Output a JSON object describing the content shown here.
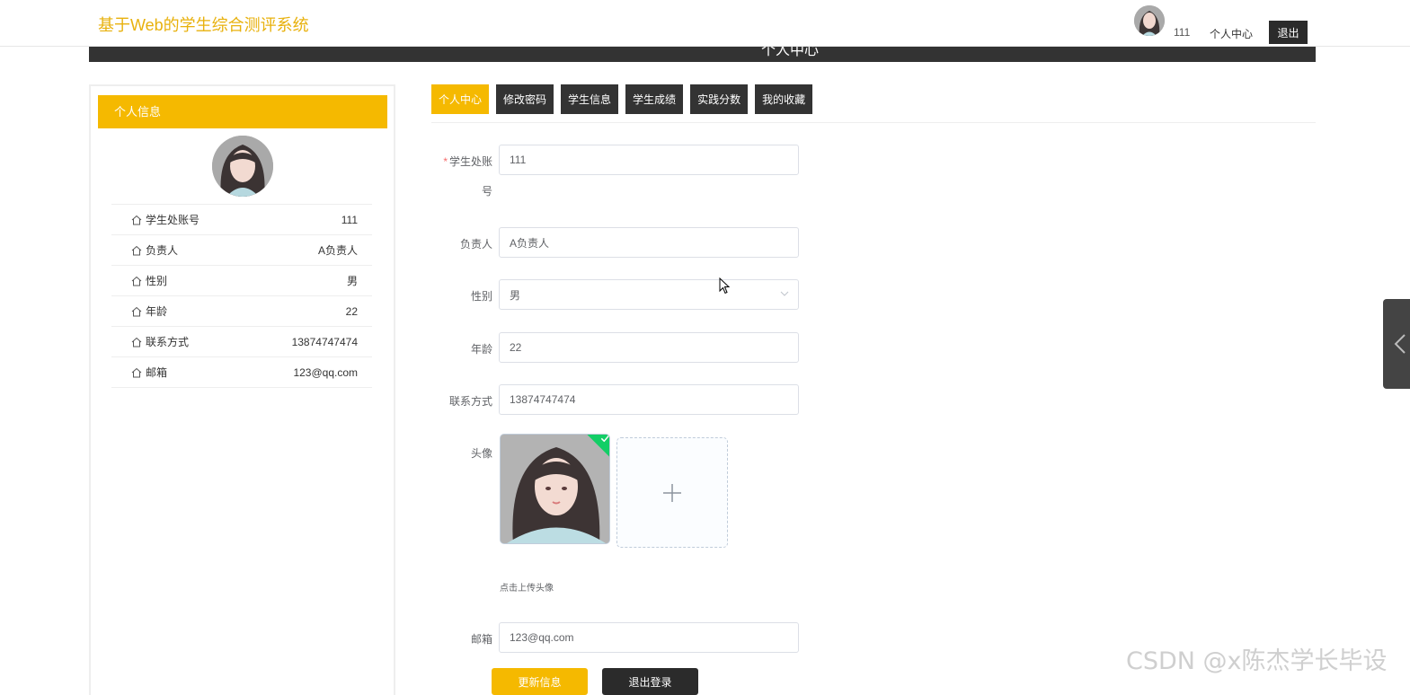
{
  "header": {
    "site_title": "基于Web的学生综合测评系统",
    "username": "111",
    "personal_center": "个人中心",
    "logout": "退出",
    "band_title": "个人中心"
  },
  "sidebar": {
    "title": "个人信息",
    "rows": [
      {
        "key": "学生处账号",
        "value": "111"
      },
      {
        "key": "负责人",
        "value": "A负责人"
      },
      {
        "key": "性别",
        "value": "男"
      },
      {
        "key": "年龄",
        "value": "22"
      },
      {
        "key": "联系方式",
        "value": "13874747474"
      },
      {
        "key": "邮箱",
        "value": "123@qq.com"
      }
    ]
  },
  "tabs": [
    {
      "label": "个人中心",
      "active": true
    },
    {
      "label": "修改密码",
      "active": false
    },
    {
      "label": "学生信息",
      "active": false
    },
    {
      "label": "学生成绩",
      "active": false
    },
    {
      "label": "实践分数",
      "active": false
    },
    {
      "label": "我的收藏",
      "active": false
    }
  ],
  "form": {
    "account_label_line1": "学生处账",
    "account_label_line2": "号",
    "account_required": "*",
    "account_value": "111",
    "manager_label": "负责人",
    "manager_placeholder": "A负责人",
    "gender_label": "性别",
    "gender_value": "男",
    "age_label": "年龄",
    "age_value": "22",
    "contact_label": "联系方式",
    "contact_value": "13874747474",
    "avatar_label": "头像",
    "upload_tip": "点击上传头像",
    "email_label": "邮箱",
    "email_value": "123@qq.com",
    "update_button": "更新信息",
    "logout_button": "退出登录"
  },
  "watermark": "CSDN @x陈杰学长毕设",
  "colors": {
    "accent": "#f5b900",
    "title": "#e8b10d",
    "dark": "#333333"
  }
}
